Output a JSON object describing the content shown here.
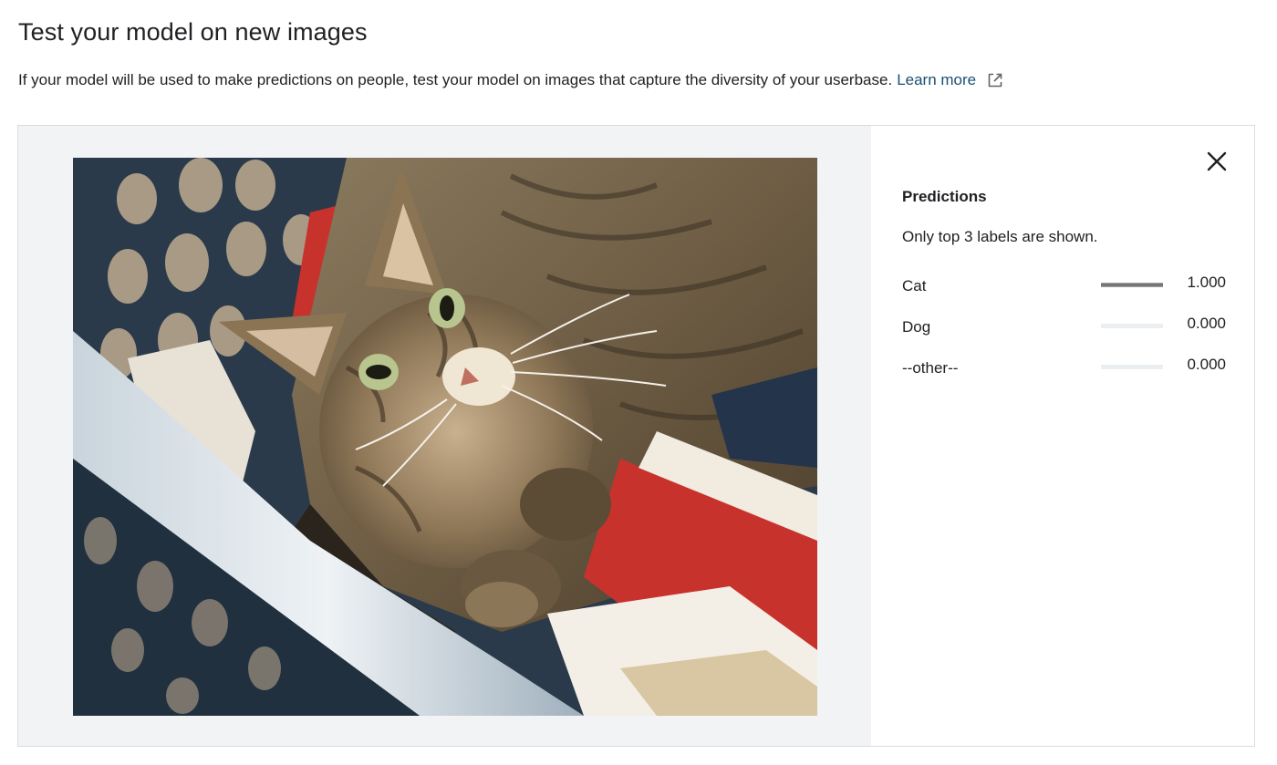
{
  "header": {
    "title": "Test your model on new images",
    "description": "If your model will be used to make predictions on people, test your model on images that capture the diversity of your userbase.",
    "learn_more": "Learn more"
  },
  "results": {
    "title": "Predictions",
    "note": "Only top 3 labels are shown.",
    "predictions": [
      {
        "label": "Cat",
        "score": "1.000",
        "value": 1.0
      },
      {
        "label": "Dog",
        "score": "0.000",
        "value": 0.0
      },
      {
        "label": "--other--",
        "score": "0.000",
        "value": 0.0
      }
    ]
  },
  "icons": {
    "external_link": "open-in-new-icon",
    "close": "close-icon"
  },
  "colors": {
    "link": "#1a4f73",
    "image_background": "#f1f3f4",
    "bar_fill": "#757575",
    "bar_track": "#eceff1"
  }
}
